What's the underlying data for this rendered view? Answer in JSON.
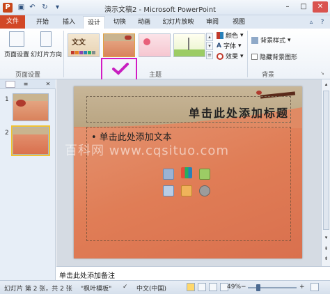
{
  "window": {
    "title": "演示文稿2 - Microsoft PowerPoint",
    "app_icon": "P"
  },
  "qat": [
    "save-icon",
    "undo-icon",
    "redo-icon",
    "customize-icon"
  ],
  "tabs": [
    {
      "id": "file",
      "label": "文件"
    },
    {
      "id": "home",
      "label": "开始"
    },
    {
      "id": "insert",
      "label": "插入"
    },
    {
      "id": "design",
      "label": "设计"
    },
    {
      "id": "transitions",
      "label": "切换"
    },
    {
      "id": "animations",
      "label": "动画"
    },
    {
      "id": "slideshow",
      "label": "幻灯片放映"
    },
    {
      "id": "review",
      "label": "审阅"
    },
    {
      "id": "view",
      "label": "视图"
    }
  ],
  "active_tab": "设计",
  "ribbon": {
    "page_setup": {
      "page_setup_label": "页面设置",
      "orientation_label": "幻灯片方向",
      "group_label": "页面设置"
    },
    "themes": {
      "group_label": "主题",
      "first_theme_text": "文文",
      "selected_index": 1
    },
    "theme_options": {
      "colors": "颜色",
      "fonts": "字体",
      "effects": "效果"
    },
    "background": {
      "styles": "背景样式",
      "hide_graphics": "隐藏背景图形",
      "group_label": "背景"
    }
  },
  "slides_pane": {
    "tab_icons": [
      "slides-tab-icon",
      "outline-tab-icon"
    ],
    "close": "✕",
    "slides": [
      "1",
      "2"
    ],
    "selected": 2
  },
  "slide": {
    "title_placeholder": "单击此处添加标题",
    "body_placeholder": "• 单击此处添加文本"
  },
  "watermark": "百科网 www.cqsituo.com",
  "notes": {
    "placeholder": "单击此处添加备注"
  },
  "status": {
    "slide_info": "幻灯片 第 2 张，共 2 张",
    "theme_name": "\"枫叶模板\"",
    "language": "中文(中国)",
    "zoom": "49%",
    "zoom_value": 49
  },
  "colors": {
    "file_tab": "#d24726",
    "selection_highlight": "#d21bc4",
    "checkmark": "#c81fc0"
  }
}
